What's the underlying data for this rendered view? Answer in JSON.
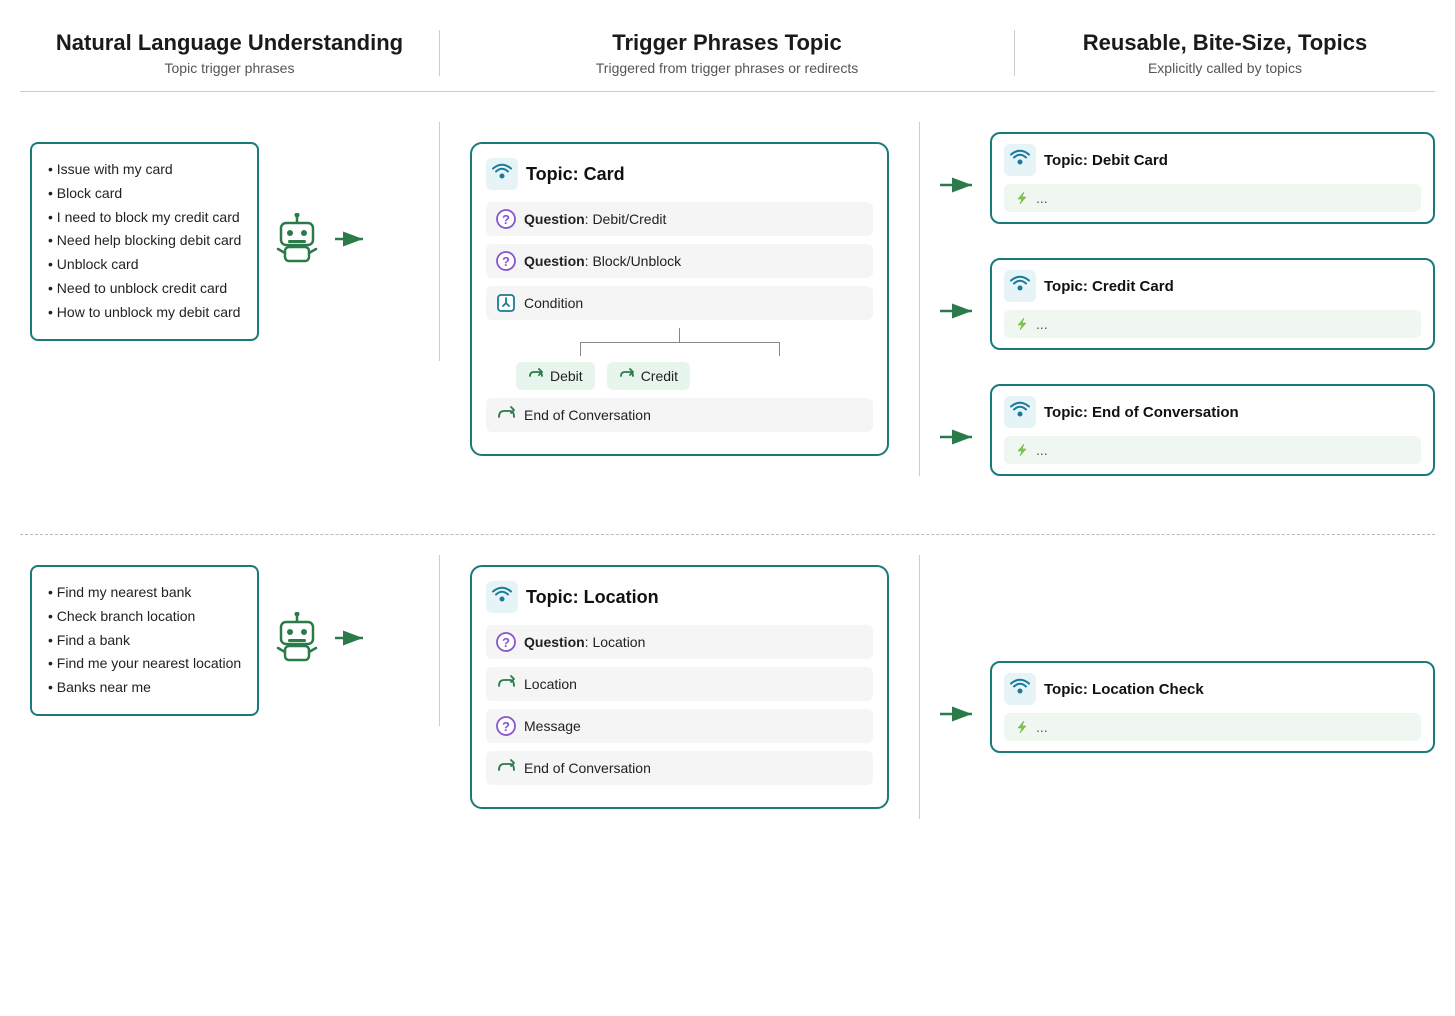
{
  "header": {
    "col1": {
      "title": "Natural Language Understanding",
      "subtitle": "Topic trigger phrases"
    },
    "col2": {
      "title": "Trigger Phrases Topic",
      "subtitle": "Triggered from trigger phrases or redirects"
    },
    "col3": {
      "title": "Reusable, Bite-Size, Topics",
      "subtitle": "Explicitly called by topics"
    }
  },
  "top_section": {
    "nlu_phrases": [
      "Issue with my card",
      "Block card",
      "I need to block my credit card",
      "Need help blocking debit card",
      "Unblock card",
      "Need to unblock credit card",
      "How to unblock my debit card"
    ],
    "topic_card": {
      "title": "Topic: Card",
      "steps": [
        {
          "type": "question",
          "label": "Question: Debit/Credit"
        },
        {
          "type": "question",
          "label": "Question: Block/Unblock"
        },
        {
          "type": "condition",
          "label": "Condition"
        }
      ],
      "branches": [
        "Debit",
        "Credit"
      ],
      "end_step": "End of Conversation"
    },
    "reusable_cards": [
      {
        "title": "Topic: Debit Card",
        "step": "..."
      },
      {
        "title": "Topic: Credit Card",
        "step": "..."
      },
      {
        "title": "Topic: End of Conversation",
        "step": "..."
      }
    ]
  },
  "bottom_section": {
    "nlu_phrases": [
      "Find my nearest bank",
      "Check branch location",
      "Find a bank",
      "Find me your nearest location",
      "Banks near me"
    ],
    "topic_card": {
      "title": "Topic: Location",
      "steps": [
        {
          "type": "question",
          "label": "Question: Location"
        },
        {
          "type": "redirect",
          "label": "Location"
        },
        {
          "type": "question",
          "label": "Message"
        },
        {
          "type": "redirect",
          "label": "End of Conversation"
        }
      ]
    },
    "reusable_cards": [
      {
        "title": "Topic: Location Check",
        "step": "..."
      }
    ]
  }
}
